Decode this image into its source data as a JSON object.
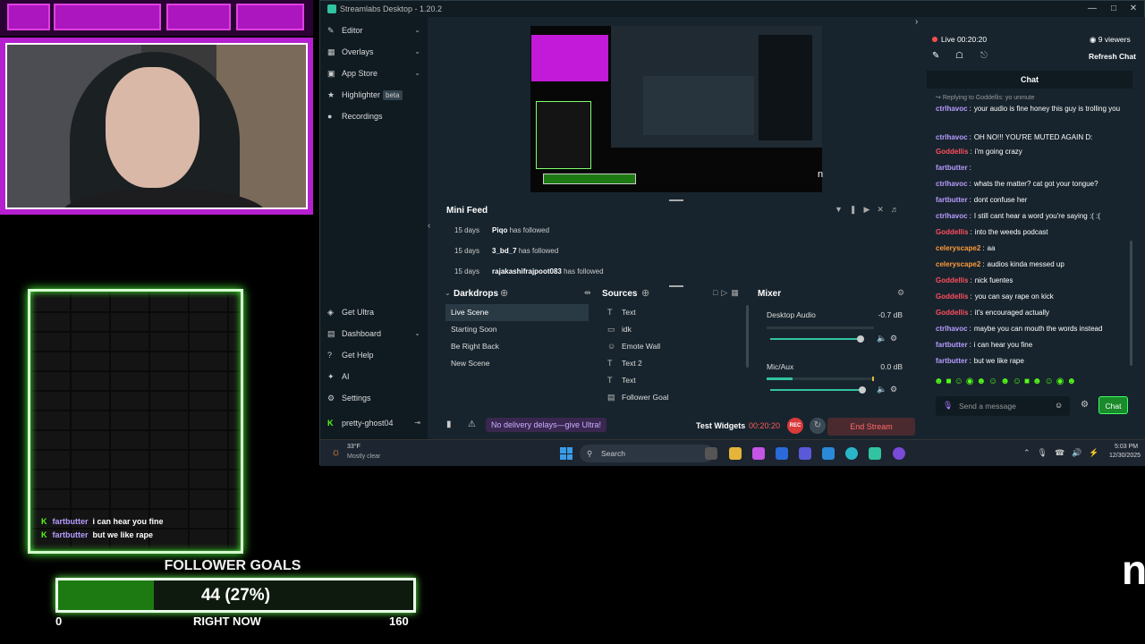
{
  "overlay": {
    "chat_lines": [
      {
        "user": "fartbutter",
        "text": "i can hear you fine"
      },
      {
        "user": "fartbutter",
        "text": "but we like rape"
      }
    ],
    "goal": {
      "title": "FOLLOWER GOALS",
      "value_text": "44 (27%)",
      "progress_fraction": 0.27,
      "min": "0",
      "max": "160",
      "sub": "RIGHT NOW"
    },
    "edge_glyph": "n"
  },
  "app": {
    "title": "Streamlabs Desktop - 1.20.2",
    "nav_top": [
      {
        "label": "Editor",
        "icon": "editor-icon"
      },
      {
        "label": "Overlays",
        "icon": "overlays-icon"
      },
      {
        "label": "App Store",
        "icon": "app-store-icon"
      },
      {
        "label": "Highlighter",
        "icon": "highlighter-icon",
        "badge": "beta"
      },
      {
        "label": "Recordings",
        "icon": "recordings-icon"
      }
    ],
    "nav_bottom": [
      {
        "label": "Get Ultra"
      },
      {
        "label": "Dashboard"
      },
      {
        "label": "Get Help"
      },
      {
        "label": "AI"
      },
      {
        "label": "Settings"
      },
      {
        "label": "pretty-ghost04"
      }
    ],
    "minifeed": {
      "title": "Mini Feed",
      "rows": [
        {
          "age": "15 days",
          "user": "Piqo",
          "action": "has followed"
        },
        {
          "age": "15 days",
          "user": "3_bd_7",
          "action": "has followed"
        },
        {
          "age": "15 days",
          "user": "rajakashifrajpoot083",
          "action": "has followed"
        }
      ]
    },
    "scenes": {
      "title": "Darkdrops",
      "items": [
        "Live Scene",
        "Starting Soon",
        "Be Right Back",
        "New Scene"
      ],
      "selected": "Live Scene"
    },
    "sources": {
      "title": "Sources",
      "items": [
        "Text",
        "idk",
        "Emote Wall",
        "Text 2",
        "Text",
        "Follower Goal"
      ]
    },
    "mixer": {
      "title": "Mixer",
      "channels": [
        {
          "name": "Desktop Audio",
          "db": "-0.7 dB"
        },
        {
          "name": "Mic/Aux",
          "db": "0.0 dB"
        }
      ]
    },
    "bottom": {
      "delay_text": "No delivery delays—give Ultra!",
      "test_widgets": "Test Widgets",
      "timer": "00:20:20",
      "rec": "REC",
      "end_stream": "End Stream"
    }
  },
  "chat": {
    "live_status": "Live 00:20:20",
    "viewers": "9 viewers",
    "refresh": "Refresh Chat",
    "title": "Chat",
    "reply_note": "Replying to Goddellis: yo unmute",
    "messages": [
      {
        "user": "ctrlhavoc",
        "text": "your audio is fine honey this guy is trolling you",
        "color": "#b79cff"
      },
      {
        "user": "ctrlhavoc",
        "text": "OH NO!!! YOU'RE MUTED AGAIN D:",
        "color": "#b79cff"
      },
      {
        "user": "Goddellis",
        "text": "i'm going crazy",
        "color": "#ff4d5e"
      },
      {
        "user": "fartbutter",
        "text": "",
        "color": "#b79cff"
      },
      {
        "user": "ctrlhavoc",
        "text": "whats the matter? cat got your tongue?",
        "color": "#b79cff"
      },
      {
        "user": "fartbutter",
        "text": "dont confuse her",
        "color": "#b79cff"
      },
      {
        "user": "ctrlhavoc",
        "text": "I still cant hear a word you're saying :( :(",
        "color": "#b79cff"
      },
      {
        "user": "Goddellis",
        "text": "into the weeds podcast",
        "color": "#ff4d5e"
      },
      {
        "user": "celeryscape2",
        "text": "aa",
        "color": "#ff9a3c"
      },
      {
        "user": "celeryscape2",
        "text": "audios kinda messed up",
        "color": "#ff9a3c"
      },
      {
        "user": "Goddellis",
        "text": "nick fuentes",
        "color": "#ff4d5e"
      },
      {
        "user": "Goddellis",
        "text": "you can say rape on kick",
        "color": "#ff4d5e"
      },
      {
        "user": "Goddellis",
        "text": "it's encouraged actually",
        "color": "#ff4d5e"
      },
      {
        "user": "ctrlhavoc",
        "text": "maybe you can mouth the words instead",
        "color": "#b79cff"
      },
      {
        "user": "fartbutter",
        "text": "i can hear you fine",
        "color": "#b79cff"
      },
      {
        "user": "fartbutter",
        "text": "but we like rape",
        "color": "#b79cff"
      }
    ],
    "input_placeholder": "Send a message",
    "send_label": "Chat"
  },
  "taskbar": {
    "weather_temp": "33°F",
    "weather_desc": "Mostly clear",
    "search": "Search",
    "time": "5:03 PM",
    "date": "12/30/2025"
  },
  "colors": {
    "accent": "#31c3a2",
    "overlay_purple": "#b51fcf",
    "neon_green": "#4dff3a",
    "kick_green": "#53fc18"
  }
}
